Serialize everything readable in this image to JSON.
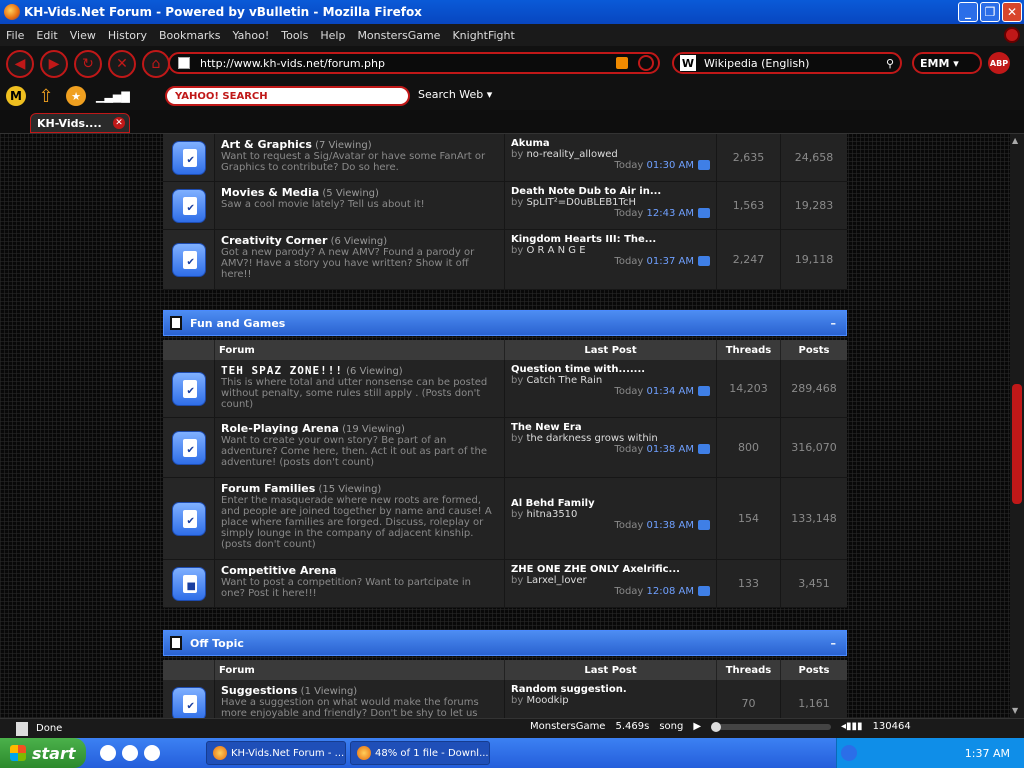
{
  "window": {
    "title": "KH-Vids.Net Forum - Powered by vBulletin - Mozilla Firefox"
  },
  "menu": [
    "File",
    "Edit",
    "View",
    "History",
    "Bookmarks",
    "Yahoo!",
    "Tools",
    "Help",
    "MonstersGame",
    "KnightFight"
  ],
  "nav": {
    "url": "http://www.kh-vids.net/forum.php",
    "search_engine": "Wikipedia (English)",
    "emm_label": "EMM",
    "abp_label": "ABP"
  },
  "yahoo": {
    "search_placeholder": "YAHOO! SEARCH",
    "search_web": "Search Web"
  },
  "tabs": [
    {
      "label": "KH-Vids...."
    }
  ],
  "columns": {
    "forum": "Forum",
    "last_post": "Last Post",
    "threads": "Threads",
    "posts": "Posts"
  },
  "top_forums": [
    {
      "name": "Art & Graphics",
      "viewing": "(7 Viewing)",
      "desc": "Want to request a Sig/Avatar or have some FanArt or Graphics to contribute? Do so here.",
      "last_title": "Akuma",
      "by": "by",
      "last_user": "no-reality_allowed",
      "today": "Today",
      "time": "01:30 AM",
      "threads": "2,635",
      "posts": "24,658"
    },
    {
      "name": "Movies & Media",
      "viewing": "(5 Viewing)",
      "desc": "Saw a cool movie lately? Tell us about it!",
      "last_title": "Death Note Dub to Air in...",
      "by": "by",
      "last_user": "SpLIT²=D0uBLEB1TcH",
      "today": "Today",
      "time": "12:43 AM",
      "threads": "1,563",
      "posts": "19,283"
    },
    {
      "name": "Creativity Corner",
      "viewing": "(6 Viewing)",
      "desc": "Got a new parody? A new AMV? Found a parody or AMV?! Have a story you have written? Show it off here!!",
      "last_title": "Kingdom Hearts III: The...",
      "by": "by",
      "last_user": "O R A N G E",
      "today": "Today",
      "time": "01:37 AM",
      "threads": "2,247",
      "posts": "19,118"
    }
  ],
  "fun_games": {
    "title": "Fun and Games",
    "collapse": "–",
    "forums": [
      {
        "name": "TEH SPAZ ZONE!!!",
        "viewing": "(6 Viewing)",
        "desc": "This is where total and utter nonsense can be posted without penalty, some rules still apply . (Posts don't count)",
        "last_title": "Question time with.......",
        "by": "by",
        "last_user": "Catch The Rain",
        "today": "Today",
        "time": "01:34 AM",
        "threads": "14,203",
        "posts": "289,468"
      },
      {
        "name": "Role-Playing Arena",
        "viewing": "(19 Viewing)",
        "desc": "Want to create your own story? Be part of an adventure? Come here, then. Act it out as part of the adventure! (posts don't count)",
        "last_title": "The New Era",
        "by": "by",
        "last_user": "the darkness grows within",
        "today": "Today",
        "time": "01:38 AM",
        "threads": "800",
        "posts": "316,070"
      },
      {
        "name": "Forum Families",
        "viewing": "(15 Viewing)",
        "desc": "Enter the masquerade where new roots are formed, and people are joined together by name and cause! A place where families are forged. Discuss, roleplay or simply lounge in the company of adjacent kinship. (posts don't count)",
        "last_title": "Al Behd Family",
        "by": "by",
        "last_user": "hitna3510",
        "today": "Today",
        "time": "01:38 AM",
        "threads": "154",
        "posts": "133,148"
      },
      {
        "name": "Competitive Arena",
        "viewing": "",
        "desc": "Want to post a competition? Want to partcipate in one? Post it here!!!",
        "last_title": "ZHE ONE ZHE ONLY Axelrific...",
        "by": "by",
        "last_user": "Larxel_lover",
        "today": "Today",
        "time": "12:08 AM",
        "threads": "133",
        "posts": "3,451"
      }
    ]
  },
  "off_topic": {
    "title": "Off Topic",
    "collapse": "–",
    "forums": [
      {
        "name": "Suggestions",
        "viewing": "(1 Viewing)",
        "desc": "Have a suggestion on what would make the forums more enjoyable and friendly? Don't be shy to let us",
        "last_title": "Random suggestion.",
        "by": "by",
        "last_user": "Moodkip",
        "today": "",
        "time": "",
        "threads": "70",
        "posts": "1,161"
      }
    ]
  },
  "status": {
    "text": "Done",
    "game": "MonstersGame",
    "timer": "5.469s",
    "song": "song",
    "count": "130464"
  },
  "taskbar": {
    "start": "start",
    "task1": "KH-Vids.Net Forum - ...",
    "task2": "48% of 1 file - Downl...",
    "clock": "1:37 AM"
  },
  "colors": {
    "accent_red": "#c01818",
    "cat_blue": "#3a78e6",
    "link_blue": "#6fa0ff"
  }
}
